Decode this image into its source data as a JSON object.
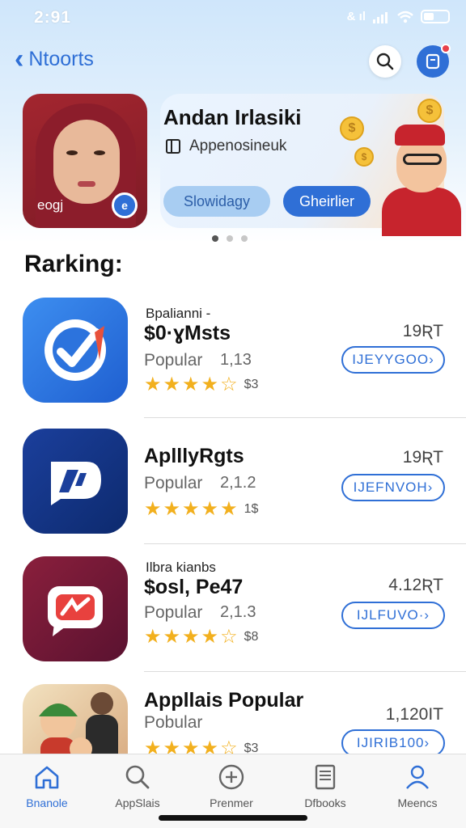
{
  "status": {
    "time": "2:91",
    "signal_text": "& ıl"
  },
  "nav": {
    "back_label": "Ntoorts",
    "search_icon": "search-icon",
    "profile_icon": "profile-icon",
    "accent": "#2f6fd6",
    "badge_color": "#e8414a"
  },
  "featured": {
    "photo_label": "eogj",
    "title": "Andan Irlasiki",
    "subtitle": "Appenosineuk",
    "secondary_button": "Slowidagy",
    "primary_button": "Gheirlier",
    "coin_symbol": "$",
    "pager_count": 3,
    "pager_active": 0
  },
  "section_title": "Rarking:",
  "apps": [
    {
      "overline": "Bpalianni -",
      "title": "$0·ɣMsts",
      "category": "Popular",
      "metric": "1,13",
      "rating": 4.5,
      "rating_count": "$3",
      "price": "19ƦT",
      "button": "IJEYYGOO›"
    },
    {
      "overline": "",
      "title": "AplllyRgts",
      "category": "Popular",
      "metric": "2,1.2",
      "rating": 5,
      "rating_count": "1$",
      "price": "19ƦT",
      "button": "IJEFNVOH›"
    },
    {
      "overline": "Ilbra kianbs",
      "title": "$osl, Pe47",
      "category": "Popular",
      "metric": "2,1.3",
      "rating": 4.5,
      "rating_count": "$8",
      "price": "4.12ƦT",
      "button": "IJLFUVO·›"
    },
    {
      "overline": "",
      "title": "Appllais Popular",
      "category": "Pobular",
      "metric": "",
      "rating": 4.5,
      "rating_count": "$3",
      "price": "1,120IT",
      "button": "IJIRIB100›"
    }
  ],
  "tabs": [
    {
      "label": "Bnanole",
      "icon": "home-icon",
      "active": true
    },
    {
      "label": "AppSlais",
      "icon": "search-icon",
      "active": false
    },
    {
      "label": "Prenmer",
      "icon": "plus-circle-icon",
      "active": false
    },
    {
      "label": "Dfbooks",
      "icon": "document-icon",
      "active": false
    },
    {
      "label": "Meencs",
      "icon": "person-icon",
      "active": false
    }
  ]
}
